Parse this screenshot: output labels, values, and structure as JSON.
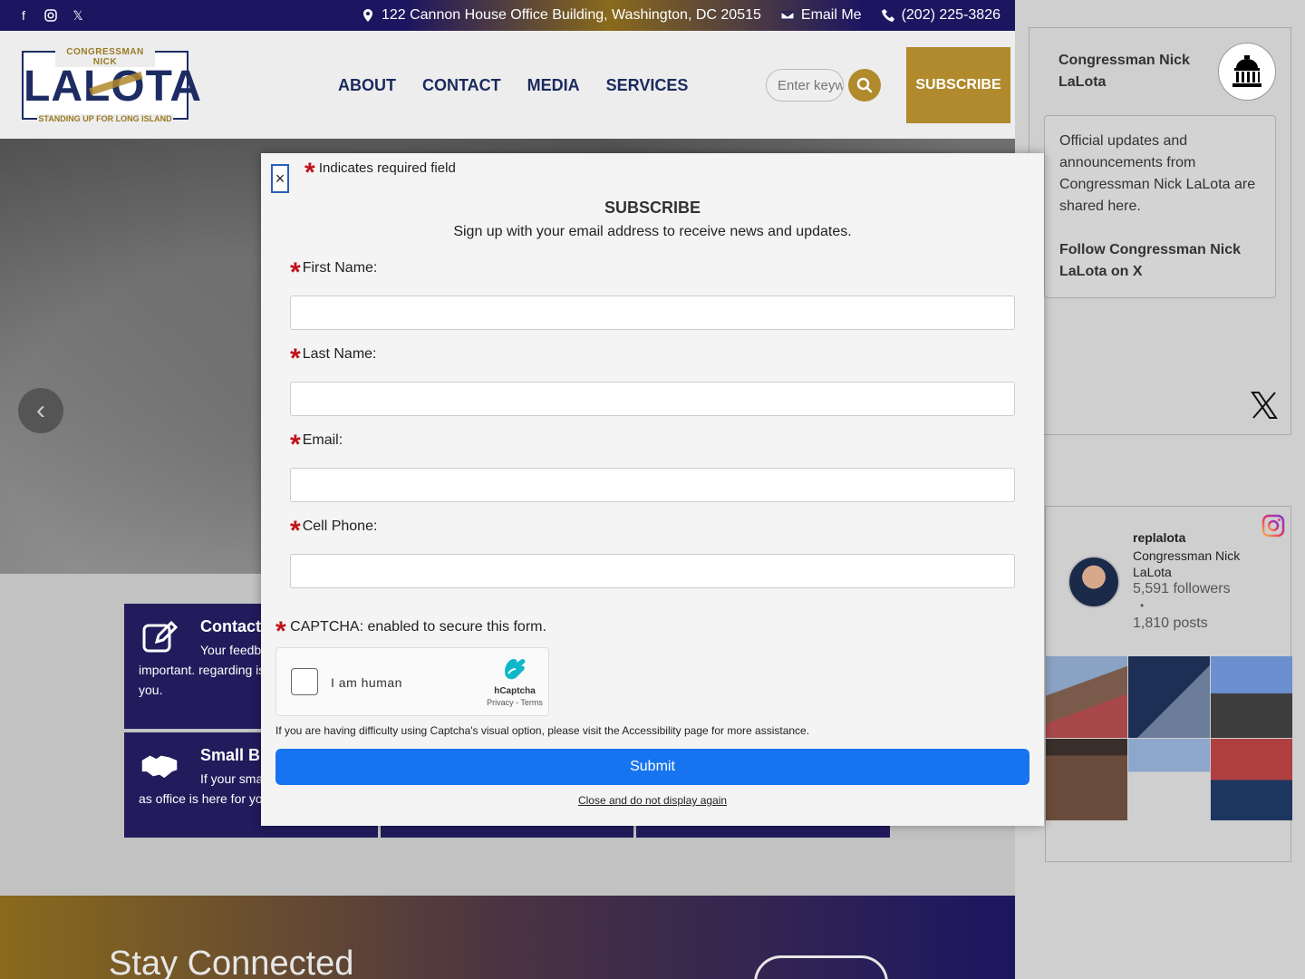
{
  "topbar": {
    "address": "122 Cannon House Office Building, Washington, DC 20515",
    "email": "Email Me",
    "phone": "(202) 225-3826"
  },
  "logo": {
    "top": "CONGRESSMAN NICK",
    "name": "LALOTA",
    "tagline": "STANDING UP FOR LONG ISLAND"
  },
  "nav": {
    "items": [
      "ABOUT",
      "CONTACT",
      "MEDIA",
      "SERVICES"
    ]
  },
  "search": {
    "placeholder": "Enter keywords"
  },
  "header_subscribe": "SUBSCRIBE",
  "cards": [
    {
      "title": "Contact",
      "text": "Your feedback is important. regarding issues that you."
    },
    {
      "title": "Small B",
      "text": "If your small need of as office is here for you."
    }
  ],
  "footer": {
    "title": "Stay Connected"
  },
  "modal": {
    "required_note": "Indicates required field",
    "title": "SUBSCRIBE",
    "subtitle": "Sign up with your email address to receive news and updates.",
    "fields": [
      {
        "label": "First Name:"
      },
      {
        "label": "Last Name:"
      },
      {
        "label": "Email:"
      },
      {
        "label": "Cell Phone:"
      }
    ],
    "captcha_label": "CAPTCHA: enabled to secure this form.",
    "captcha_checkbox": "I am human",
    "captcha_brand": "hCaptcha",
    "captcha_links": "Privacy - Terms",
    "accessibility_note": "If you are having difficulty using Captcha's visual option, please visit the Accessibility page for more assistance.",
    "submit": "Submit",
    "dont_show": "Close and do not display again",
    "close": "×"
  },
  "sidebar": {
    "x": {
      "name": "Congressman Nick LaLota",
      "bio": "Official updates and announcements from Congressman Nick LaLota are shared here.",
      "follow": "Follow Congressman Nick LaLota on X"
    },
    "instagram": {
      "handle": "replalota",
      "full_name": "Congressman Nick LaLota",
      "followers": "5,591 followers",
      "dot": "•",
      "posts": "1,810 posts"
    }
  },
  "colors": {
    "navy": "#1c1661",
    "gold": "#b08a2c",
    "submit_blue": "#1774f0",
    "required_red": "#c0121b"
  }
}
